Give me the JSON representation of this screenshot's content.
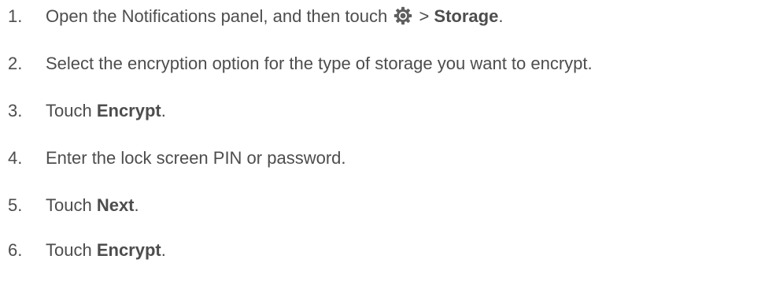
{
  "steps": [
    {
      "number": "1.",
      "text_before": "Open the Notifications panel, and then touch",
      "icon": "gear-icon",
      "text_sep": " > ",
      "bold": "Storage",
      "text_after": "."
    },
    {
      "number": "2.",
      "text": "Select the encryption option for the type of storage you want to encrypt."
    },
    {
      "number": "3.",
      "text_before": "Touch ",
      "bold": "Encrypt",
      "text_after": "."
    },
    {
      "number": "4.",
      "text": "Enter the lock screen PIN or password."
    },
    {
      "number": "5.",
      "text_before": "Touch ",
      "bold": "Next",
      "text_after": "."
    },
    {
      "number": "6.",
      "text_before": "Touch ",
      "bold": "Encrypt",
      "text_after": "."
    }
  ],
  "colors": {
    "text": "#4d4d4d",
    "icon": "#5f5f5f"
  }
}
